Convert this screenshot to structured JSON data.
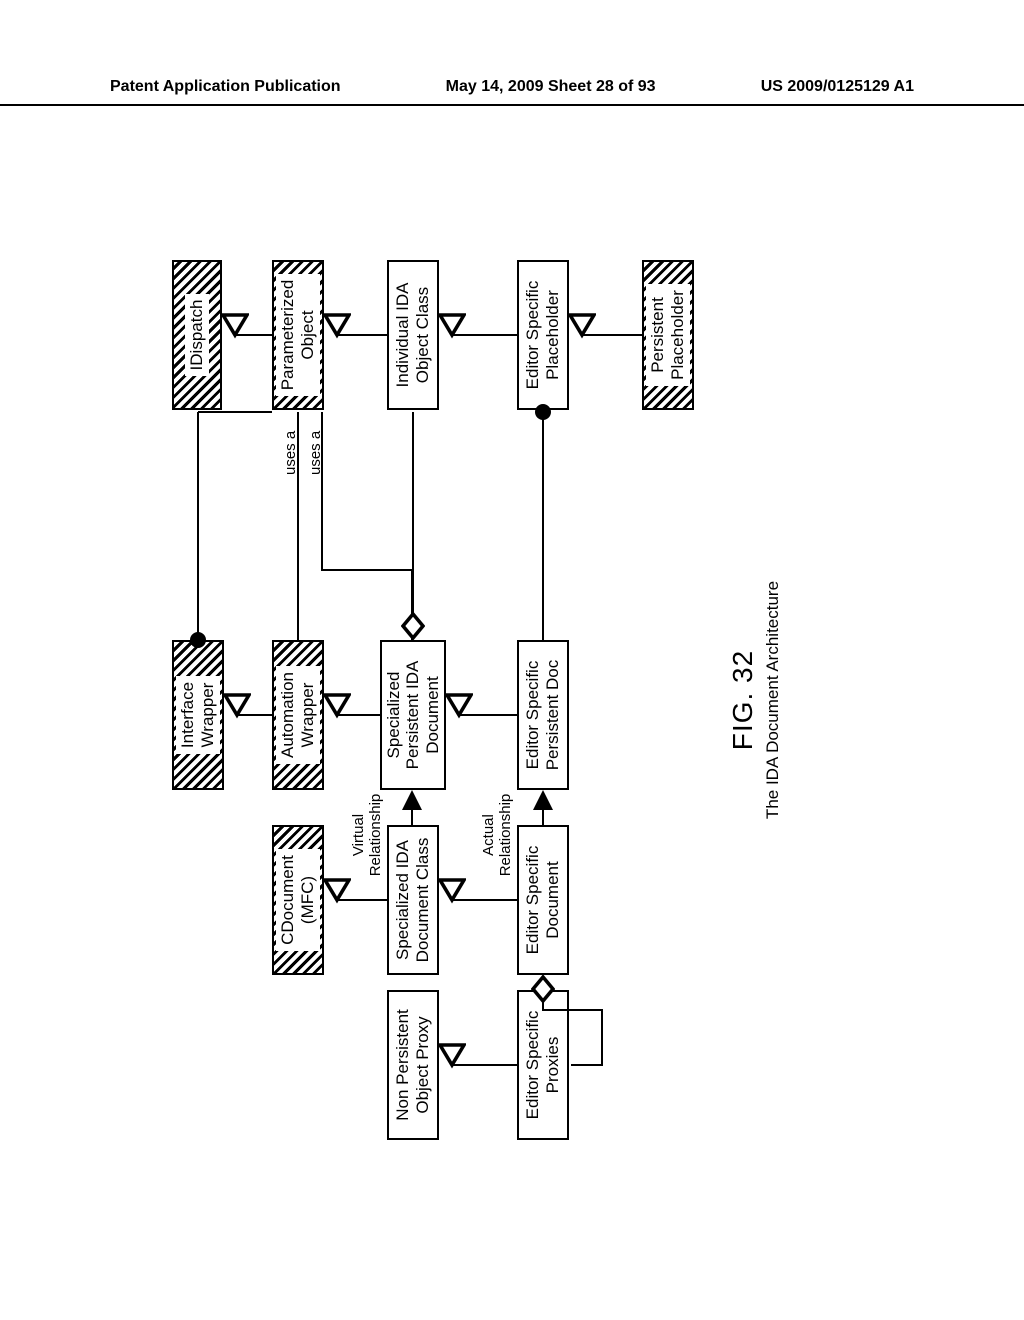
{
  "header": {
    "left": "Patent Application Publication",
    "center": "May 14, 2009  Sheet 28 of 93",
    "right": "US 2009/0125129 A1"
  },
  "nodes": {
    "nonPersistentProxy": "Non Persistent\nObject Proxy",
    "editorProxies": "Editor Specific\nProxies",
    "cdocument": "CDocument\n(MFC)",
    "specializedIdaDocClass": "Specialized IDA\nDocument Class",
    "editorSpecDocument": "Editor Specific\nDocument",
    "interfaceWrapper": "Interface\nWrapper",
    "automationWrapper": "Automation\nWrapper",
    "specializedPersistentIdaDoc": "Specialized\nPersistent IDA\nDocument",
    "editorSpecPersistentDoc": "Editor Specific\nPersistent Doc",
    "idispatch": "IDispatch",
    "parameterizedObject": "Parameterized\nObject",
    "individualIdaObjClass": "Individual IDA\nObject Class",
    "editorSpecPlaceholder": "Editor Specific\nPlaceholder",
    "persistentPlaceholder": "Persistent\nPlaceholder"
  },
  "edgeLabels": {
    "virtualRelationship": "Virtual\nRelationship",
    "actualRelationship": "Actual\nRelationship",
    "usesA1": "uses a",
    "usesA2": "uses a"
  },
  "caption": {
    "fignum": "FIG. 32",
    "title": "The IDA Document Architecture"
  }
}
